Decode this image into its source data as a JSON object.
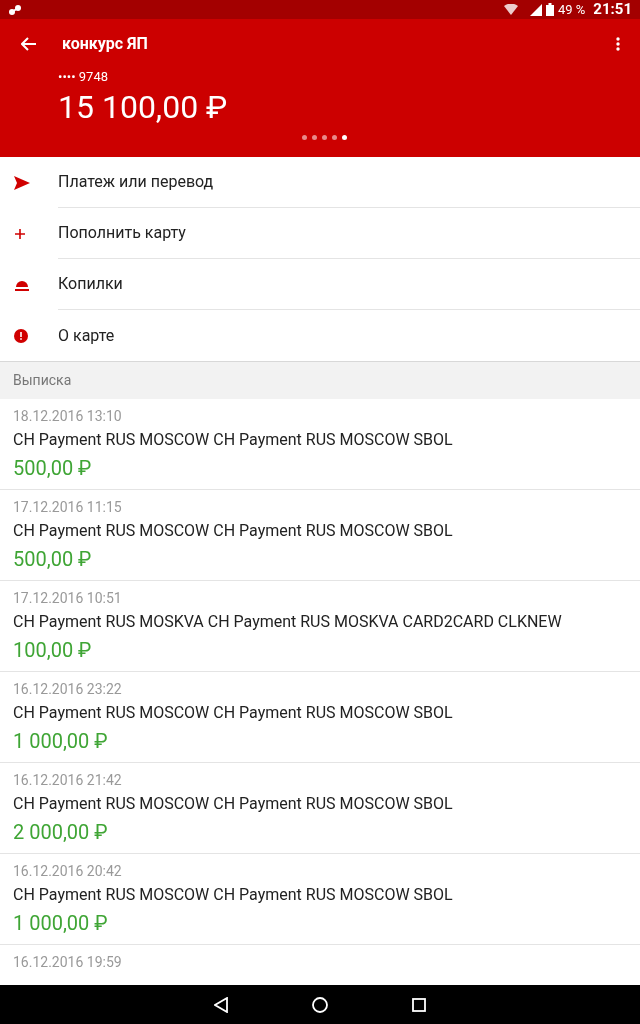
{
  "status_bar": {
    "battery": "49 %",
    "time": "21:51"
  },
  "header": {
    "title": "конкурс ЯП",
    "card_number": "•••• 9748",
    "balance": "15 100,00 ₽",
    "pages": [
      {
        "selected": false
      },
      {
        "selected": false
      },
      {
        "selected": false
      },
      {
        "selected": false
      },
      {
        "selected": true
      }
    ]
  },
  "menu": [
    {
      "kind": "send",
      "label": "Платеж или перевод"
    },
    {
      "kind": "plus",
      "label": "Пополнить карту"
    },
    {
      "kind": "piggy",
      "label": "Копилки"
    },
    {
      "kind": "info",
      "label": "О карте"
    }
  ],
  "statement": {
    "title": "Выписка",
    "rows": [
      {
        "date": "18.12.2016 13:10",
        "description": "CH Payment RUS MOSCOW CH Payment RUS MOSCOW SBOL",
        "amount": "500,00 ₽"
      },
      {
        "date": "17.12.2016 11:15",
        "description": "CH Payment RUS MOSCOW CH Payment RUS MOSCOW SBOL",
        "amount": "500,00 ₽"
      },
      {
        "date": "17.12.2016 10:51",
        "description": "CH Payment RUS MOSKVA CH Payment RUS MOSKVA CARD2CARD CLKNEW",
        "amount": "100,00 ₽"
      },
      {
        "date": "16.12.2016 23:22",
        "description": "CH Payment RUS MOSCOW CH Payment RUS MOSCOW SBOL",
        "amount": "1 000,00 ₽"
      },
      {
        "date": "16.12.2016 21:42",
        "description": "CH Payment RUS MOSCOW CH Payment RUS MOSCOW SBOL",
        "amount": "2 000,00 ₽"
      },
      {
        "date": "16.12.2016 20:42",
        "description": "CH Payment RUS MOSCOW CH Payment RUS MOSCOW SBOL",
        "amount": "1 000,00 ₽"
      },
      {
        "date": "16.12.2016 19:59"
      }
    ]
  }
}
